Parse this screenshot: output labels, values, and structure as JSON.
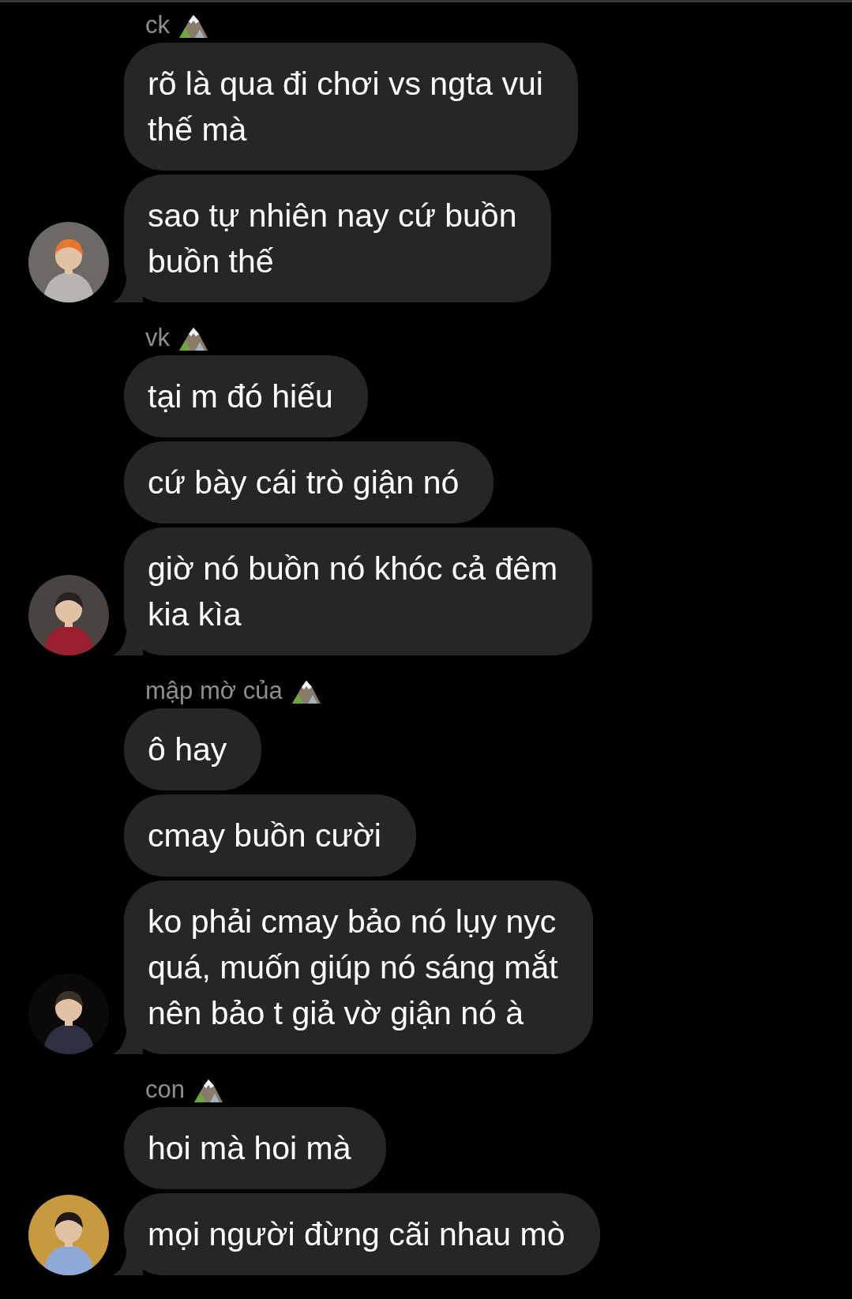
{
  "groups": [
    {
      "sender": "ck",
      "messages": [
        "rõ là qua đi chơi vs ngta vui\nthế mà",
        "sao tự nhiên nay cứ buồn\nbuồn thế"
      ]
    },
    {
      "sender": "vk",
      "messages": [
        "tại m đó hiếu",
        "cứ bày cái trò giận nó",
        "giờ nó buồn nó khóc cả đêm\nkia kìa"
      ]
    },
    {
      "sender": "mập mờ của",
      "messages": [
        "ô hay",
        "cmay buồn cười",
        "ko phải cmay bảo nó lụy nyc\nquá, muốn giúp nó sáng mắt\nnên bảo t giả vờ giận nó à"
      ]
    },
    {
      "sender": "con",
      "messages": [
        "hoi mà hoi mà",
        "mọi người đừng cãi nhau mò"
      ]
    }
  ]
}
